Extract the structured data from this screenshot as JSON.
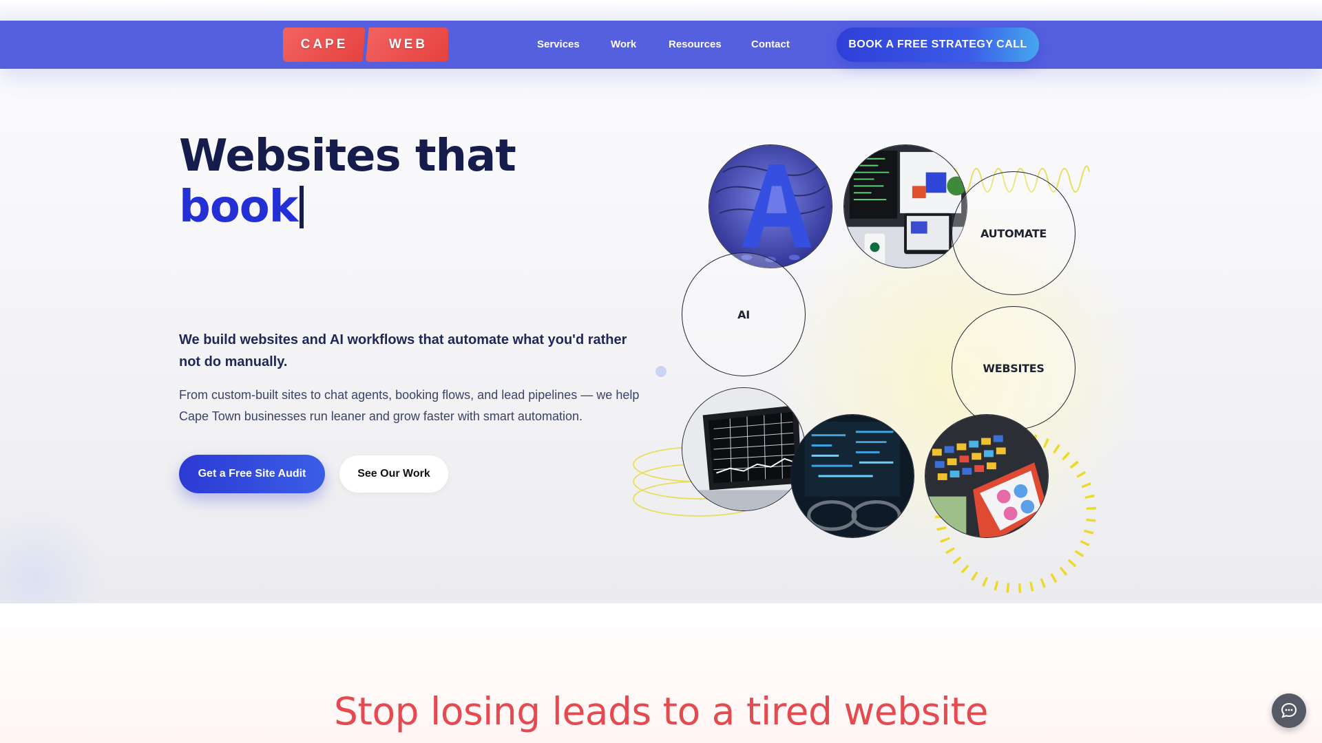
{
  "brand": {
    "logo_left": "CAPE",
    "logo_right": "WEB",
    "logo_color": "#e5413f"
  },
  "nav": {
    "background": "#5560df",
    "links": [
      "Services",
      "Work",
      "Resources",
      "Contact"
    ],
    "cta_label": "BOOK A FREE STRATEGY CALL"
  },
  "hero": {
    "headline_line1": "Websites that",
    "headline_typed": "book",
    "subheading": "We build websites and AI workflows that automate what you'd rather not do manually.",
    "body": "From custom-built sites to chat agents, booking flows, and lead pipelines — we help Cape Town businesses run leaner and grow faster with smart automation.",
    "primary_button": "Get a Free Site Audit",
    "secondary_button": "See Our Work",
    "accent_color": "#2330d6",
    "bubbles": {
      "automate": "AUTOMATE",
      "ai": "AI",
      "websites": "WEBSITES"
    }
  },
  "section2": {
    "title": "Stop losing leads to a tired website",
    "title_color": "#e44a4f"
  },
  "chat_widget": {
    "icon": "chat-bubble-icon"
  }
}
